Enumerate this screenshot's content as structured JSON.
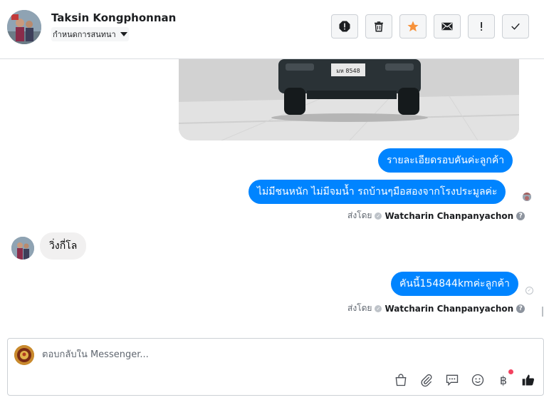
{
  "header": {
    "contact_name": "Taksin Kongphonnan",
    "assign_label": "กำหนดการสนทนา",
    "actions": [
      {
        "name": "mark-spam-button",
        "icon": "alert-octagon-icon"
      },
      {
        "name": "delete-button",
        "icon": "trash-icon"
      },
      {
        "name": "star-button",
        "icon": "star-icon"
      },
      {
        "name": "mark-unread-button",
        "icon": "envelope-icon"
      },
      {
        "name": "follow-up-button",
        "icon": "exclamation-icon"
      },
      {
        "name": "mark-done-button",
        "icon": "checkmark-icon"
      }
    ]
  },
  "thread": {
    "messages": [
      {
        "direction": "outgoing",
        "text": "รายละเอียดรอบคันค่ะลูกค้า"
      },
      {
        "direction": "outgoing",
        "text": "ไม่มีชนหนัก ไม่มีจมน้ำ รถบ้านๆมือสองจากโรงประมูลค่ะ"
      },
      {
        "direction": "incoming",
        "text": "วิ่งกี่โล"
      },
      {
        "direction": "outgoing",
        "text": "คันนี้154844kmค่ะลูกค้า"
      }
    ],
    "sent_by_prefix": "ส่งโดย",
    "sent_by_name": "Watcharin Chanpanyachon",
    "help_mark": "?",
    "plate_text": "มห 8548"
  },
  "composer": {
    "placeholder": "ตอบกลับใน Messenger...",
    "value": "",
    "baht_symbol": "฿",
    "tools": [
      "shopping-bag-icon",
      "paperclip-icon",
      "saved-replies-icon",
      "emoji-icon",
      "payment-icon",
      "like-icon"
    ]
  },
  "colors": {
    "outgoing_bubble": "#0084ff",
    "incoming_bubble": "#f1f0f0",
    "star": "#f7923b"
  }
}
